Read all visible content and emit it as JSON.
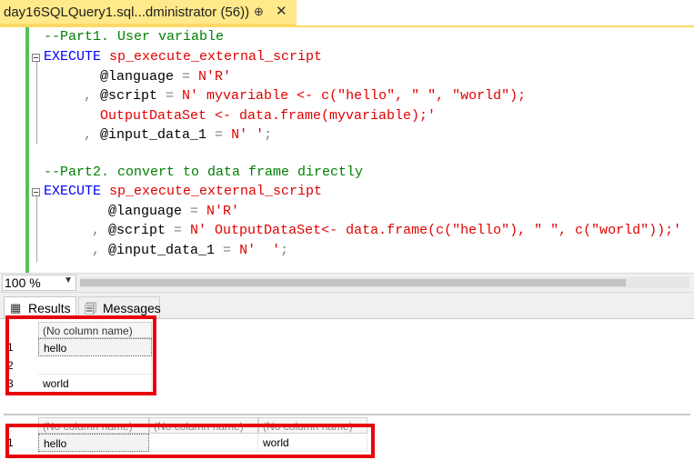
{
  "tab": {
    "title": "day16SQLQuery1.sql...dministrator (56))",
    "pin_icon": "pin-icon",
    "close_icon": "close-icon",
    "pin_glyph": "⊕",
    "close_glyph": "✕"
  },
  "editor": {
    "lines": {
      "l1_comment": "--Part1. User variable",
      "l2_kw": "EXECUTE",
      "l2_proc": " sp_execute_external_script",
      "l3_param": "@language",
      "l3_eq": " = ",
      "l3_str": "N'R'",
      "l4_comma": ", ",
      "l4_param": "@script",
      "l4_eq": " = ",
      "l4_str": "N' myvariable <- c(\"hello\", \" \", \"world\");",
      "l5_str": "OutputDataSet <- data.frame(myvariable);'",
      "l6_comma": ", ",
      "l6_param": "@input_data_1",
      "l6_eq": " = ",
      "l6_str": "N' '",
      "l6_semi": ";",
      "l8_comment": "--Part2. convert to data frame directly",
      "l9_kw": "EXECUTE",
      "l9_proc": " sp_execute_external_script",
      "l10_param": "@language",
      "l10_eq": " = ",
      "l10_str": "N'R'",
      "l11_comma": ", ",
      "l11_param": "@script",
      "l11_eq": " = ",
      "l11_str": "N' OutputDataSet<- data.frame(c(\"hello\"), \" \", c(\"world\"));'",
      "l12_comma": ", ",
      "l12_param": "@input_data_1",
      "l12_eq": " = ",
      "l12_str": "N'  '",
      "l12_semi": ";"
    }
  },
  "zoom": {
    "value": "100 %",
    "arrow": "▼"
  },
  "result_tabs": {
    "results_label": "Results",
    "messages_label": "Messages",
    "results_icon_glyph": "▦",
    "messages_icon_glyph": "🗐"
  },
  "grid1": {
    "header": "(No column name)",
    "rows": [
      {
        "num": "1",
        "value": "hello"
      },
      {
        "num": "2",
        "value": ""
      },
      {
        "num": "3",
        "value": "world"
      }
    ]
  },
  "grid2": {
    "headers": [
      "(No column name)",
      "(No column name)",
      "(No column name)"
    ],
    "rows": [
      {
        "num": "1",
        "values": [
          "hello",
          "",
          "world"
        ]
      }
    ]
  },
  "colors": {
    "keyword": "#0000ff",
    "comment": "#008000",
    "string": "#e00000",
    "highlight_box": "#e8000b",
    "tab_active": "#ffe98a"
  }
}
